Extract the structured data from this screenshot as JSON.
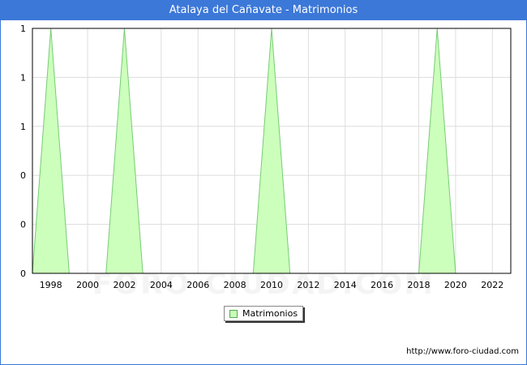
{
  "window": {
    "title": "Atalaya del Cañavate - Matrimonios",
    "source_url": "http://www.foro-ciudad.com",
    "watermark": "FORO-CIUDAD.COM"
  },
  "chart_data": {
    "type": "area",
    "title": "Atalaya del Cañavate - Matrimonios",
    "xlabel": "",
    "ylabel": "",
    "x": [
      1997,
      1998,
      1999,
      2000,
      2001,
      2002,
      2003,
      2004,
      2005,
      2006,
      2007,
      2008,
      2009,
      2010,
      2011,
      2012,
      2013,
      2014,
      2015,
      2016,
      2017,
      2018,
      2019,
      2020,
      2021,
      2022,
      2023
    ],
    "series": [
      {
        "name": "Matrimonios",
        "values": [
          0,
          1,
          0,
          0,
          0,
          1,
          0,
          0,
          0,
          0,
          0,
          0,
          0,
          1,
          0,
          0,
          0,
          0,
          0,
          0,
          0,
          0,
          1,
          0,
          0,
          0,
          0
        ],
        "fill_color": "#ccffbb",
        "line_color": "#77cc77"
      }
    ],
    "x_ticks": [
      "1998",
      "2000",
      "2002",
      "2004",
      "2006",
      "2008",
      "2010",
      "2012",
      "2014",
      "2016",
      "2018",
      "2020",
      "2022"
    ],
    "y_ticks": [
      "0",
      "0",
      "0",
      "1",
      "1",
      "1"
    ],
    "xlim": [
      1997,
      2023
    ],
    "ylim": [
      0,
      1
    ],
    "grid": true,
    "legend_position": "bottom-center"
  }
}
